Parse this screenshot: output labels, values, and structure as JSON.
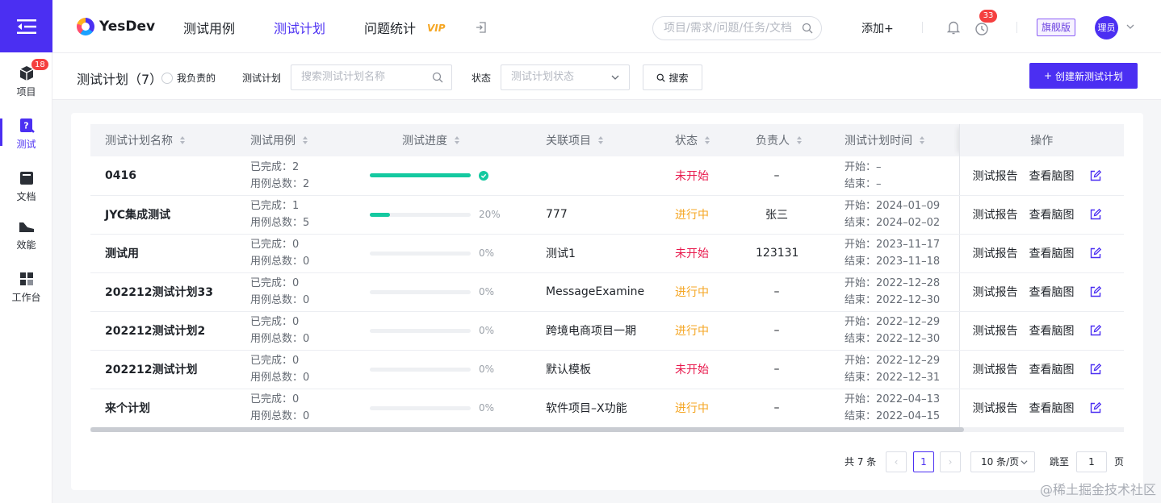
{
  "rail": {
    "project_badge": "18",
    "items": [
      {
        "label": "项目",
        "icon": "cube-icon"
      },
      {
        "label": "测试",
        "icon": "test-icon"
      },
      {
        "label": "文档",
        "icon": "doc-icon"
      },
      {
        "label": "效能",
        "icon": "efficiency-icon"
      },
      {
        "label": "工作台",
        "icon": "workbench-icon"
      }
    ]
  },
  "header": {
    "brand": "YesDev",
    "nav": [
      "测试用例",
      "测试计划",
      "问题统计"
    ],
    "vip": "VIP",
    "search_placeholder": "项目/需求/问题/任务/文档",
    "add_label": "添加+",
    "notification_badge": "33",
    "edition": "旗舰版",
    "avatar": "理员"
  },
  "filter": {
    "title": "测试计划（7）",
    "mine_label": "我负责的",
    "plan_label": "测试计划",
    "plan_placeholder": "搜索测试计划名称",
    "status_label": "状态",
    "status_placeholder": "测试计划状态",
    "search_button": "搜索",
    "create_button": "创建新测试计划"
  },
  "table": {
    "columns": [
      "测试计划名称",
      "测试用例",
      "测试进度",
      "关联项目",
      "状态",
      "负责人",
      "测试计划时间",
      "操作"
    ],
    "done_prefix": "已完成：",
    "total_prefix": "用例总数：",
    "start_prefix": "开始：",
    "end_prefix": "结束：",
    "op_report": "测试报告",
    "op_mindmap": "查看脑图",
    "rows": [
      {
        "name": "0416",
        "done": "2",
        "total": "2",
        "progress": 100,
        "progress_label": "",
        "project": "",
        "status": "未开始",
        "owner": "–",
        "start": "–",
        "end": "–"
      },
      {
        "name": "JYC集成测试",
        "done": "1",
        "total": "5",
        "progress": 20,
        "progress_label": "20%",
        "project": "777",
        "status": "进行中",
        "owner": "张三",
        "start": "2024–01–09",
        "end": "2024–02–02"
      },
      {
        "name": "测试用",
        "done": "0",
        "total": "0",
        "progress": 0,
        "progress_label": "0%",
        "project": "测试1",
        "status": "未开始",
        "owner": "123131",
        "start": "2023–11–17",
        "end": "2023–11–18"
      },
      {
        "name": "202212测试计划33",
        "done": "0",
        "total": "0",
        "progress": 0,
        "progress_label": "0%",
        "project": "MessageExamine",
        "status": "进行中",
        "owner": "–",
        "start": "2022–12–28",
        "end": "2022–12–30"
      },
      {
        "name": "202212测试计划2",
        "done": "0",
        "total": "0",
        "progress": 0,
        "progress_label": "0%",
        "project": "跨境电商项目一期",
        "status": "进行中",
        "owner": "–",
        "start": "2022–12–29",
        "end": "2022–12–30"
      },
      {
        "name": "202212测试计划",
        "done": "0",
        "total": "0",
        "progress": 0,
        "progress_label": "0%",
        "project": "默认模板",
        "status": "未开始",
        "owner": "–",
        "start": "2022–12–29",
        "end": "2022–12–31"
      },
      {
        "name": "来个计划",
        "done": "0",
        "total": "0",
        "progress": 0,
        "progress_label": "0%",
        "project": "软件项目–X功能",
        "status": "进行中",
        "owner": "–",
        "start": "2022–04–13",
        "end": "2022–04–15"
      }
    ]
  },
  "pagination": {
    "total": "共 7 条",
    "current": "1",
    "page_size": "10 条/页",
    "jump_label": "跳至",
    "jump_value": "1",
    "page_unit": "页"
  },
  "watermark": "@稀土掘金技术社区",
  "colors": {
    "accent": "#4b2ff2",
    "not_started": "#e8184c",
    "in_progress": "#f5a623",
    "progress": "#14c9a0"
  }
}
